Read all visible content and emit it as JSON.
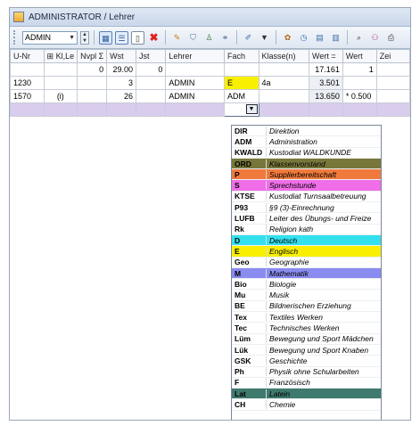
{
  "window": {
    "title": "ADMINISTRATOR / Lehrer"
  },
  "toolbar": {
    "selector_value": "ADMIN"
  },
  "grid": {
    "headers": [
      "U-Nr",
      "⊞ Kl,Le",
      "Nvpl Σ",
      "Wst",
      "Jst",
      "Lehrer",
      "Fach",
      "Klasse(n)",
      "Wert =",
      "Wert",
      "Zei"
    ],
    "rows": [
      [
        "",
        "",
        "0",
        "29.00",
        "0",
        "",
        "",
        "",
        "17.161",
        "1",
        ""
      ],
      [
        "1230",
        "",
        "",
        "3",
        "",
        "ADMIN",
        "E",
        "4a",
        "3.501",
        "",
        ""
      ],
      [
        "1570",
        "(i)",
        "",
        "26",
        "",
        "ADMIN",
        "ADM",
        "",
        "13.650",
        "* 0.500",
        ""
      ]
    ]
  },
  "dropdown": {
    "items": [
      {
        "code": "DIR",
        "name": "Direktion",
        "color": ""
      },
      {
        "code": "ADM",
        "name": "Administration",
        "color": ""
      },
      {
        "code": "KWALD",
        "name": "Kustodiat WALDKUNDE",
        "color": ""
      },
      {
        "code": "ORD",
        "name": "Klassenvorstand",
        "color": "#77773a"
      },
      {
        "code": "P",
        "name": "Supplierbereitschaft",
        "color": "#f07a3c"
      },
      {
        "code": "S",
        "name": "Sprechstunde",
        "color": "#f06ee8"
      },
      {
        "code": "KTSE",
        "name": "Kustodiat Turnsaalbetreuung",
        "color": ""
      },
      {
        "code": "P93",
        "name": "§9 (3)-Einrechnung",
        "color": ""
      },
      {
        "code": "LUFB",
        "name": "Leiter des Übungs- und Freize",
        "color": ""
      },
      {
        "code": "Rk",
        "name": "Religion kath",
        "color": ""
      },
      {
        "code": "D",
        "name": "Deutsch",
        "color": "#33e0ee"
      },
      {
        "code": "E",
        "name": "Englisch",
        "color": "#f8f000"
      },
      {
        "code": "Geo",
        "name": "Geographie",
        "color": ""
      },
      {
        "code": "M",
        "name": "Mathematik",
        "color": "#8a8cf0"
      },
      {
        "code": "Bio",
        "name": "Biologie",
        "color": ""
      },
      {
        "code": "Mu",
        "name": "Musik",
        "color": ""
      },
      {
        "code": "BE",
        "name": "Bildnerischen Erziehung",
        "color": ""
      },
      {
        "code": "Tex",
        "name": "Textiles Werken",
        "color": ""
      },
      {
        "code": "Tec",
        "name": "Technisches Werken",
        "color": ""
      },
      {
        "code": "Lüm",
        "name": "Bewegung und Sport Mädchen",
        "color": ""
      },
      {
        "code": "Lük",
        "name": "Bewegung und Sport Knaben",
        "color": ""
      },
      {
        "code": "GSK",
        "name": "Geschichte",
        "color": ""
      },
      {
        "code": "Ph",
        "name": "Physik ohne Schularbeiten",
        "color": ""
      },
      {
        "code": "F",
        "name": "Französisch",
        "color": ""
      },
      {
        "code": "Lat",
        "name": "Latein",
        "color": "#3f7a6e"
      },
      {
        "code": "CH",
        "name": "Chemie",
        "color": ""
      },
      {
        "code": "",
        "name": "",
        "color": ""
      }
    ]
  },
  "colors": {
    "fach_e": "#f8f000",
    "edit_row": "#d9cdee"
  }
}
